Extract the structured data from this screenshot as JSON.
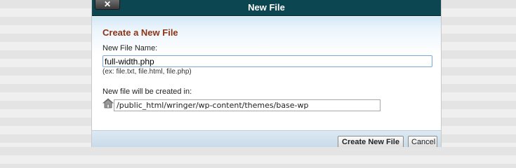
{
  "dialog": {
    "title": "New File",
    "close_label": "✕"
  },
  "form": {
    "heading": "Create a New File",
    "filename_label": "New File Name:",
    "filename_value": "full-width.php",
    "filename_hint": "(ex: file.txt, file.html, file.php)",
    "directory_label": "New file will be created in:",
    "directory_value": "/public_html/wringer/wp-content/themes/base-wp"
  },
  "footer": {
    "create_label": "Create New File",
    "cancel_label": "Cancel"
  },
  "icons": {
    "close": "close-icon",
    "directory": "home-folder-icon"
  }
}
